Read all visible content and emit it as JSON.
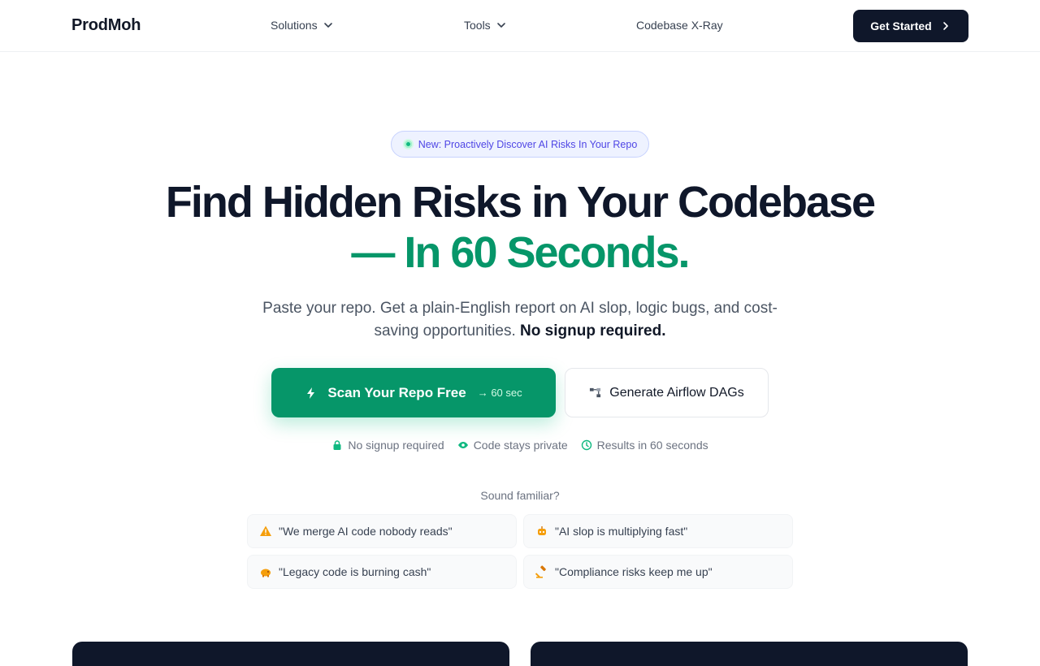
{
  "header": {
    "logo": "ProdMoh",
    "nav": {
      "solutions": "Solutions",
      "tools": "Tools",
      "xray": "Codebase X-Ray"
    },
    "cta": "Get Started"
  },
  "hero": {
    "badge": "New: Proactively Discover AI Risks In Your Repo",
    "headline_line1": "Find Hidden Risks in Your Codebase",
    "headline_line2": "— In 60 Seconds.",
    "subtext": "Paste your repo. Get a plain-English report on AI slop, logic bugs, and cost-saving opportunities.",
    "subtext_bold": "No signup required.",
    "primary_button": "Scan Your Repo Free",
    "primary_button_time": "→ 60 sec",
    "secondary_button": "Generate Airflow DAGs",
    "assurances": [
      "No signup required",
      "Code stays private",
      "Results in 60 seconds"
    ]
  },
  "familiar": {
    "heading": "Sound familiar?",
    "quotes": [
      {
        "text": "\"We merge AI code nobody reads\"",
        "icon": "warning-icon"
      },
      {
        "text": "\"AI slop is multiplying fast\"",
        "icon": "robot-icon"
      },
      {
        "text": "\"Legacy code is burning cash\"",
        "icon": "piggy-bank-icon"
      },
      {
        "text": "\"Compliance risks keep me up\"",
        "icon": "gavel-icon"
      }
    ]
  },
  "colors": {
    "accent": "#069669",
    "dark": "#0f172a",
    "badge_text": "#4f46e5"
  }
}
